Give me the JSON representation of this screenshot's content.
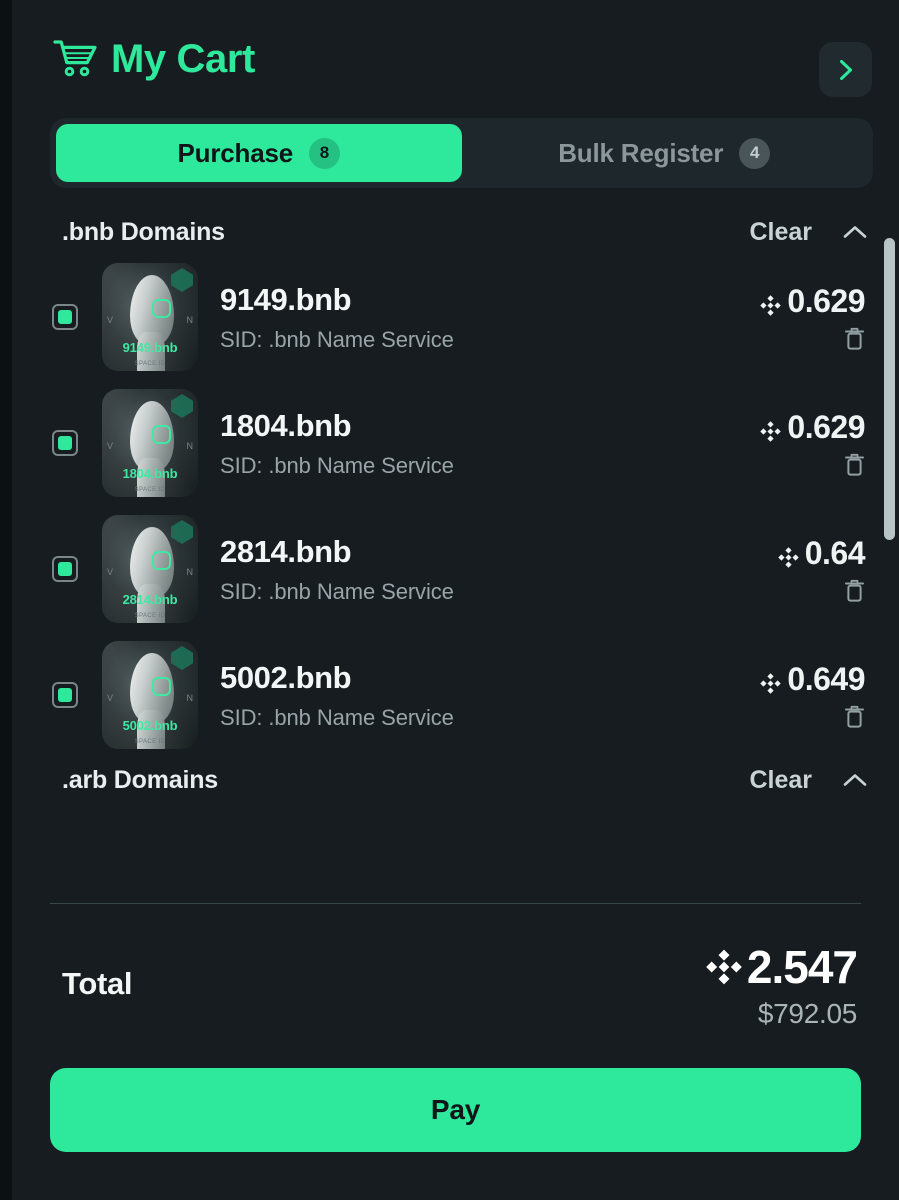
{
  "theme": {
    "accent": "#2ee89b",
    "panel_bg": "#161c1f",
    "page_bg": "#0d1214",
    "text_primary": "#f2f6f7",
    "text_muted": "#99a4a8",
    "badge_inactive": "#4a5559"
  },
  "header": {
    "title": "My Cart",
    "cart_icon": "shopping-cart-icon",
    "expand_icon": "chevron-right-icon"
  },
  "tabs": [
    {
      "label": "Purchase",
      "badge": "8",
      "active": true
    },
    {
      "label": "Bulk Register",
      "badge": "4",
      "active": false
    }
  ],
  "sections": [
    {
      "title": ".bnb Domains",
      "clear_label": "Clear",
      "collapse_icon": "chevron-up-icon",
      "items": [
        {
          "name": "9149.bnb",
          "subtitle": "SID: .bnb Name Service",
          "price": "0.629",
          "currency_icon": "bnb-icon",
          "checked": true,
          "thumb_label": "9149.bnb",
          "thumb_brand": "SPACE ID",
          "thumb_side_left": "V",
          "thumb_side_right": "N",
          "delete_icon": "trash-icon"
        },
        {
          "name": "1804.bnb",
          "subtitle": "SID: .bnb Name Service",
          "price": "0.629",
          "currency_icon": "bnb-icon",
          "checked": true,
          "thumb_label": "1804.bnb",
          "thumb_brand": "SPACE ID",
          "thumb_side_left": "V",
          "thumb_side_right": "N",
          "delete_icon": "trash-icon"
        },
        {
          "name": "2814.bnb",
          "subtitle": "SID: .bnb Name Service",
          "price": "0.64",
          "currency_icon": "bnb-icon",
          "checked": true,
          "thumb_label": "2814.bnb",
          "thumb_brand": "SPACE ID",
          "thumb_side_left": "V",
          "thumb_side_right": "N",
          "delete_icon": "trash-icon"
        },
        {
          "name": "5002.bnb",
          "subtitle": "SID: .bnb Name Service",
          "price": "0.649",
          "currency_icon": "bnb-icon",
          "checked": true,
          "thumb_label": "5002.bnb",
          "thumb_brand": "SPACE ID",
          "thumb_side_left": "V",
          "thumb_side_right": "N",
          "delete_icon": "trash-icon"
        }
      ]
    },
    {
      "title": ".arb Domains",
      "clear_label": "Clear",
      "collapse_icon": "chevron-up-icon",
      "items": []
    }
  ],
  "footer": {
    "total_label": "Total",
    "total_crypto": "2.547",
    "total_currency_icon": "bnb-icon",
    "total_fiat": "$792.05",
    "pay_label": "Pay"
  },
  "scrollbar": {
    "orientation": "vertical"
  }
}
